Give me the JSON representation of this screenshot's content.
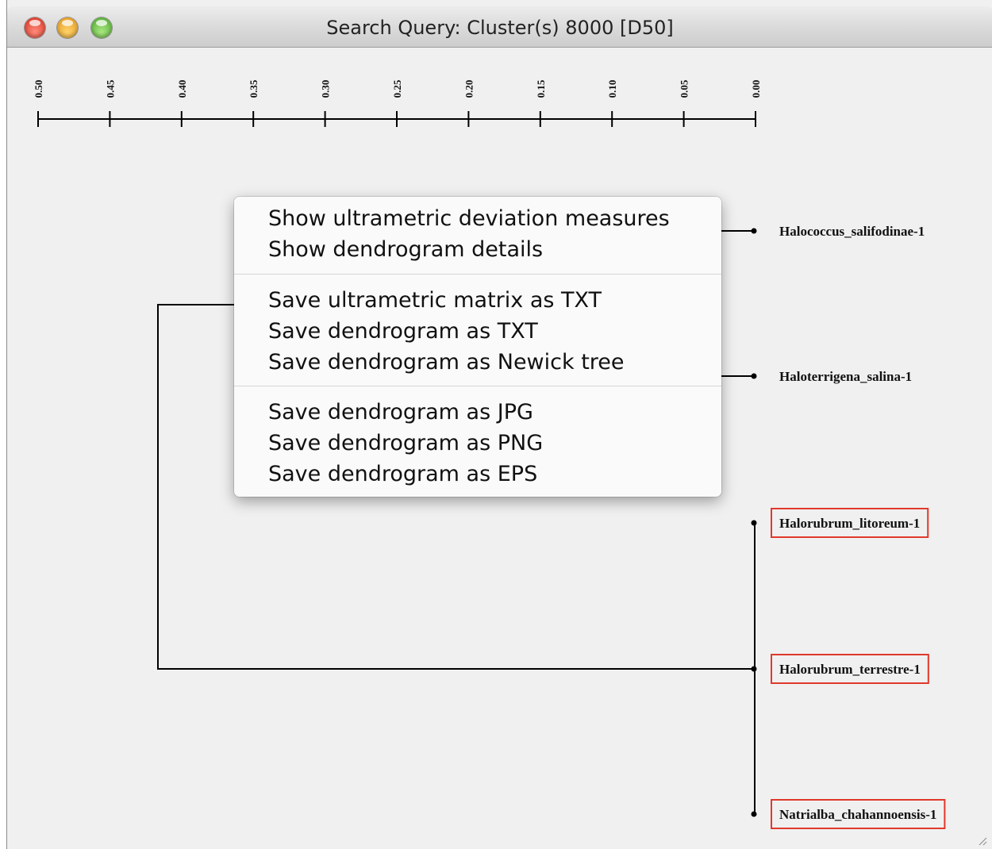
{
  "window": {
    "title": "Search Query: Cluster(s) 8000 [D50]",
    "controls": [
      "close-icon",
      "minimize-icon",
      "zoom-icon"
    ]
  },
  "axis": {
    "ticks": [
      "0.50",
      "0.45",
      "0.40",
      "0.35",
      "0.30",
      "0.25",
      "0.20",
      "0.15",
      "0.10",
      "0.05",
      "0.00"
    ]
  },
  "leaves": [
    {
      "label": "Halococcus_salifodinae-1",
      "highlighted": false
    },
    {
      "label": "Haloterrigena_salina-1",
      "highlighted": false
    },
    {
      "label": "Halorubrum_litoreum-1",
      "highlighted": true
    },
    {
      "label": "Halorubrum_terrestre-1",
      "highlighted": true
    },
    {
      "label": "Natrialba_chahannoensis-1",
      "highlighted": true
    }
  ],
  "context_menu": {
    "groups": [
      [
        "Show ultrametric deviation measures",
        "Show dendrogram details"
      ],
      [
        "Save ultrametric matrix as TXT",
        "Save dendrogram as TXT",
        "Save dendrogram as Newick tree"
      ],
      [
        "Save dendrogram as JPG",
        "Save dendrogram as PNG",
        "Save dendrogram as EPS"
      ]
    ]
  },
  "colors": {
    "highlight_border": "#e0392b",
    "background": "#f0f0f0"
  }
}
